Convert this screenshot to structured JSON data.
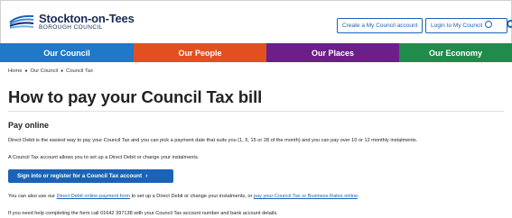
{
  "header": {
    "logo_line1": "Stockton-on-Tees",
    "logo_line2": "BOROUGH COUNCIL",
    "create_account": "Create a My Council account",
    "login": "Login to My Council",
    "search_icon": "search-icon"
  },
  "nav": {
    "items": [
      {
        "label": "Our Council",
        "color": "#1f78c8"
      },
      {
        "label": "Our People",
        "color": "#e1501e"
      },
      {
        "label": "Our Places",
        "color": "#6b2089"
      },
      {
        "label": "Our Economy",
        "color": "#1f8c4b"
      }
    ]
  },
  "breadcrumb": [
    "Home",
    "Our Council",
    "Council Tax"
  ],
  "main": {
    "title": "How to pay your Council Tax bill",
    "section_heading": "Pay online",
    "p1": "Direct Debit is the easiest way to pay your Council Tax and you can pick a payment date that suits you (1, 5, 15 or 28 of the month) and you can pay over 10 or 12 monthly instalments.",
    "p2": "A Council Tax account allows you to set up a Direct Debit or change your instalments.",
    "cta": "Sign into or register for a Council Tax account",
    "p3_before": "You can also use our ",
    "p3_link1": "Direct Debit online payment form",
    "p3_middle": " to set up a Direct Debit or change your instalments, or ",
    "p3_link2": "pay your Council Tax or Business Rates online",
    "p3_after": ".",
    "p4": "If you need help completing the form call 01642 397138 with your Council Tax account number and bank account details."
  }
}
